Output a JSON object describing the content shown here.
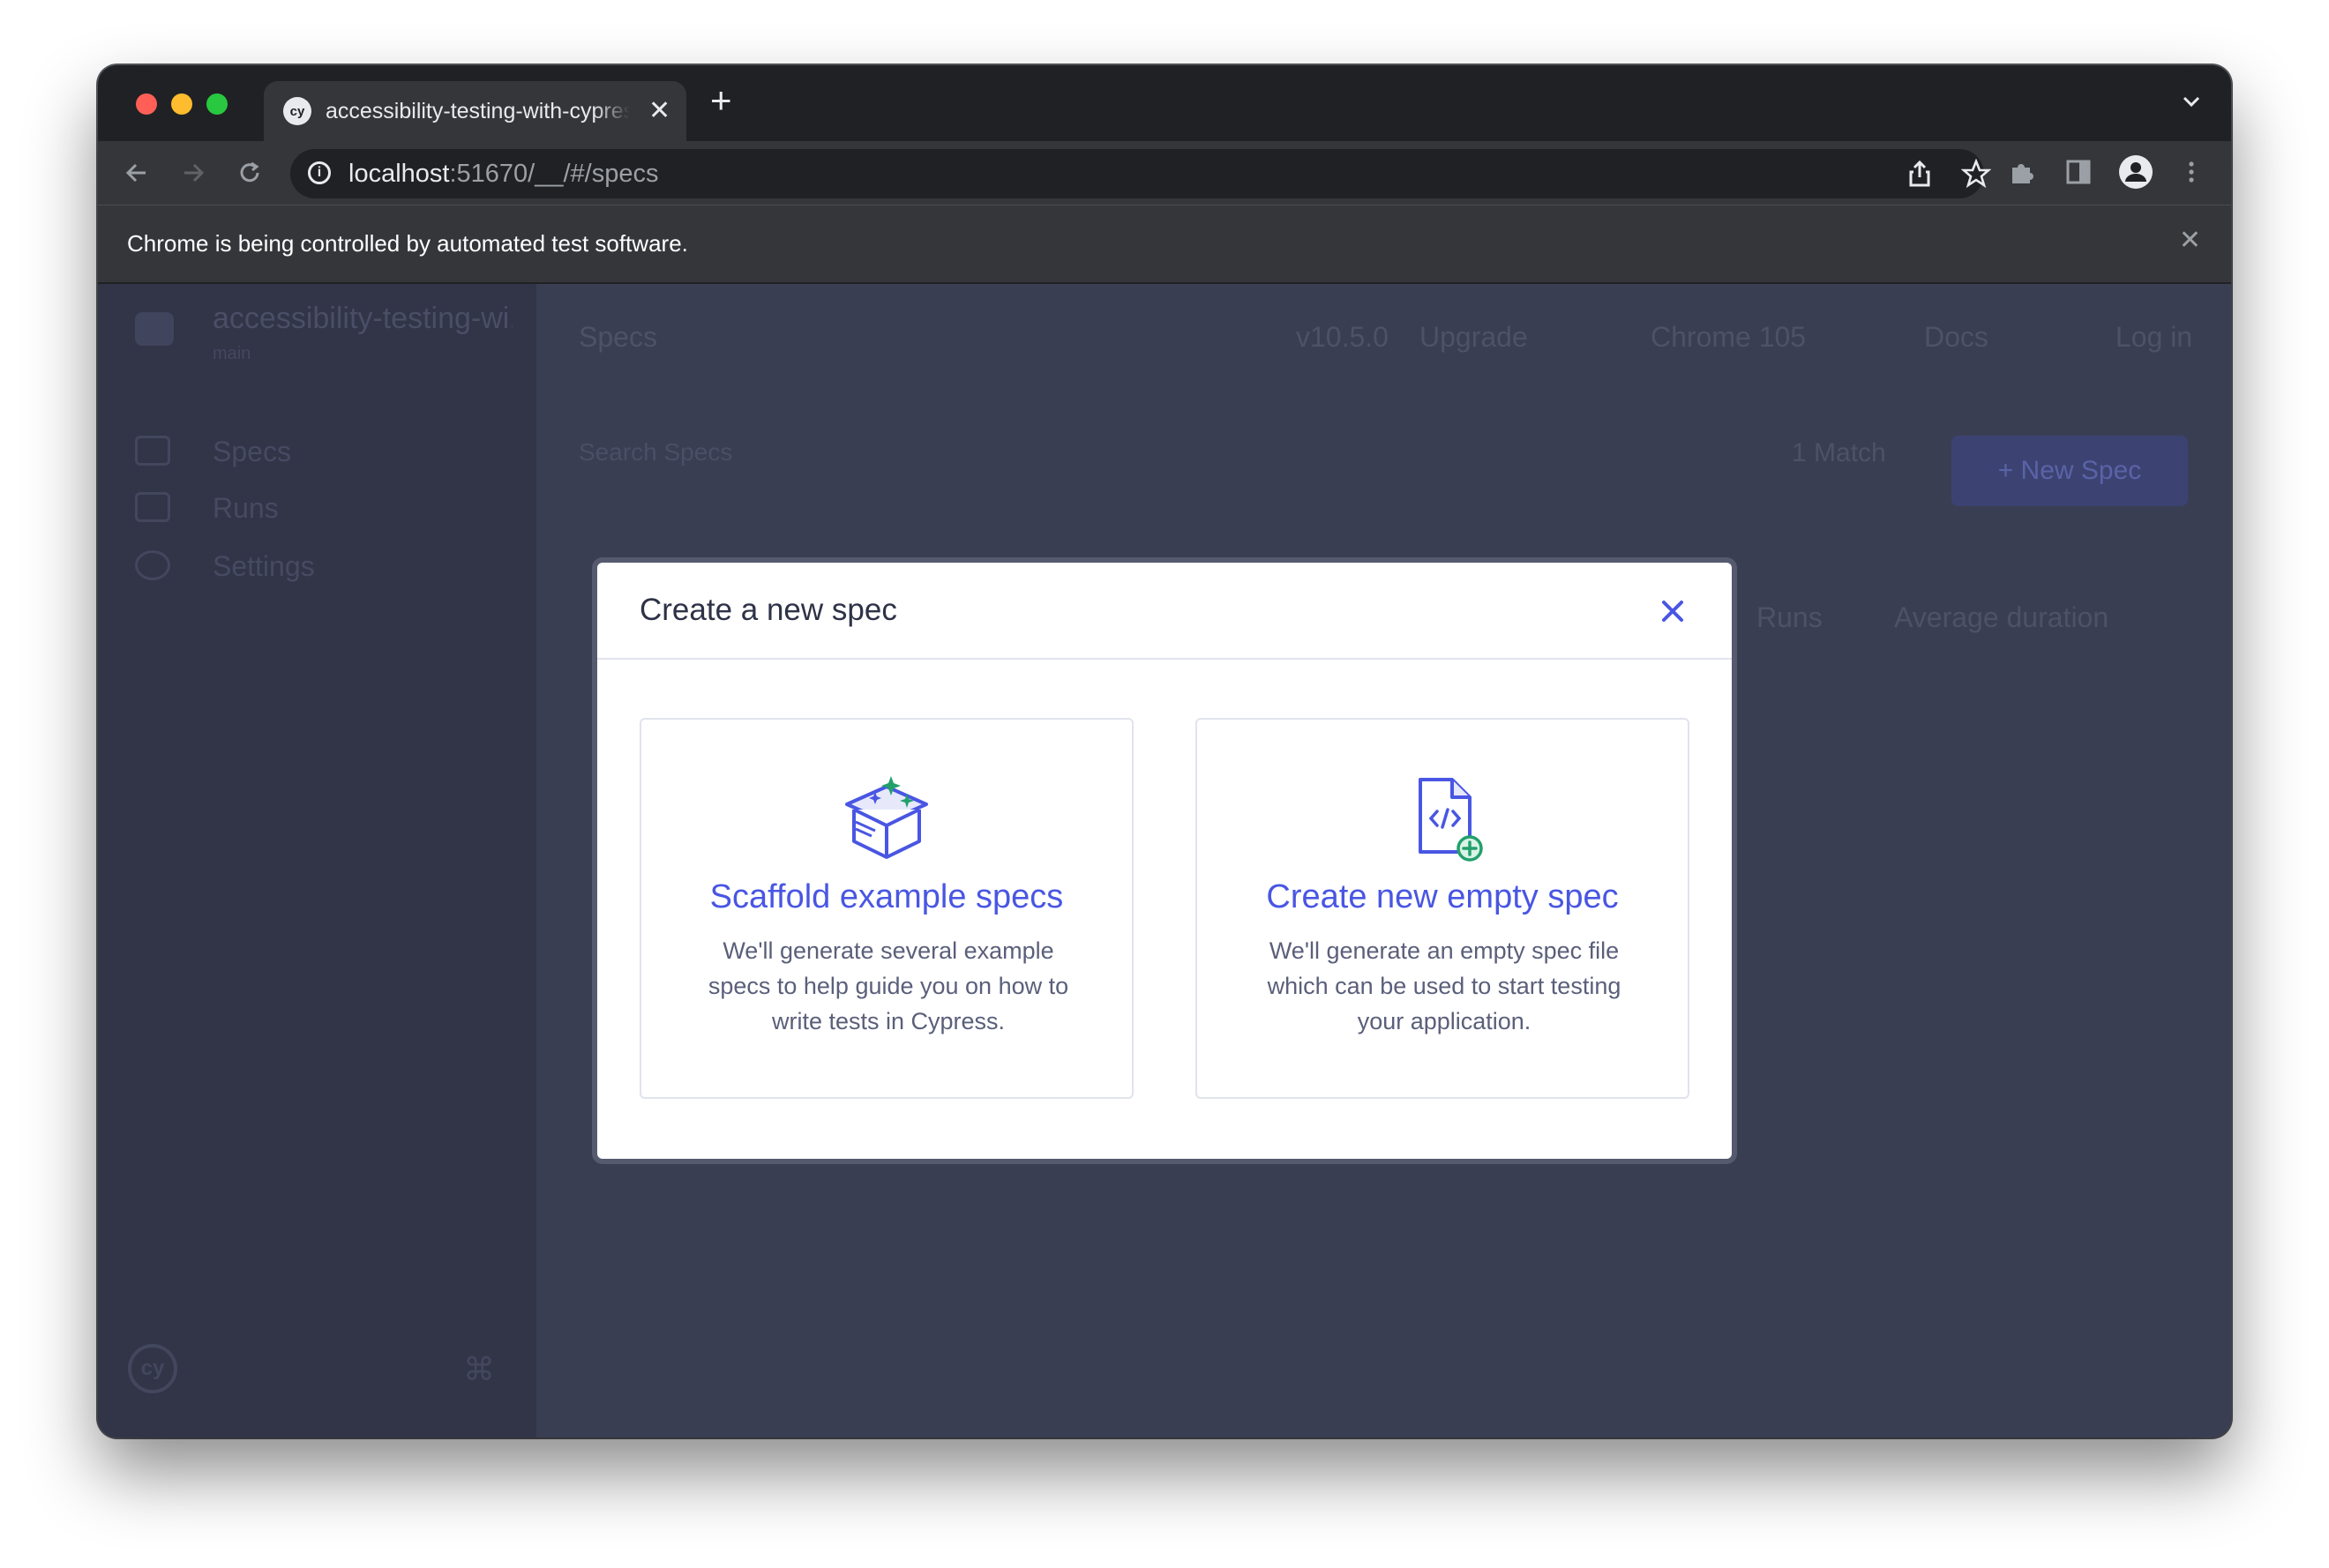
{
  "browser": {
    "tab_title": "accessibility-testing-with-cypress",
    "tab_favicon": "cy",
    "url_host": "localhost",
    "url_rest": ":51670/__/#/specs",
    "infobar_text": "Chrome is being controlled by automated test software."
  },
  "app": {
    "project_name": "accessibility-testing-wi...",
    "branch": "main",
    "sidebar_items": [
      "Specs",
      "Runs",
      "Settings"
    ],
    "page_title": "Specs",
    "version": "v10.5.0",
    "upgrade": "Upgrade",
    "browser": "Chrome 105",
    "docs": "Docs",
    "login": "Log in",
    "search_placeholder": "Search Specs",
    "match": "1 Match",
    "new_spec": "+ New Spec",
    "col_runs": "Runs",
    "col_duration": "Average duration"
  },
  "modal": {
    "title": "Create a new spec",
    "cards": [
      {
        "title": "Scaffold example specs",
        "description": "We'll generate several example specs to help guide you on how to write tests in Cypress."
      },
      {
        "title": "Create new empty spec",
        "description": "We'll generate an empty spec file which can be used to start testing your application."
      }
    ]
  },
  "colors": {
    "accent": "#4956e3",
    "green_accent": "#22a06b",
    "overlay": "#3a3e53"
  }
}
